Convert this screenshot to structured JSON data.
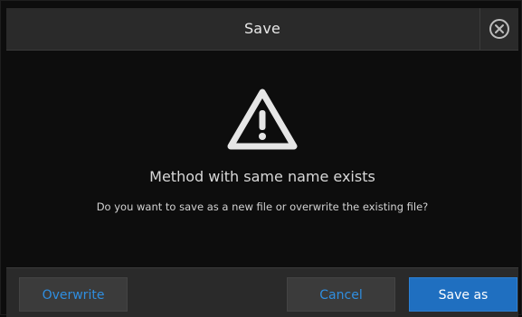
{
  "dialog": {
    "title": "Save",
    "close_icon": "close-circle-icon",
    "warning_icon": "warning-triangle-icon",
    "headline": "Method with same name exists",
    "message": "Do you want to save as a new file or overwrite the existing file?"
  },
  "buttons": {
    "overwrite": "Overwrite",
    "cancel": "Cancel",
    "save_as": "Save as"
  },
  "colors": {
    "background": "#0d0d0d",
    "bar": "#2a2a2a",
    "accent_text": "#2f8ee0",
    "primary_button": "#1f6fc0"
  }
}
